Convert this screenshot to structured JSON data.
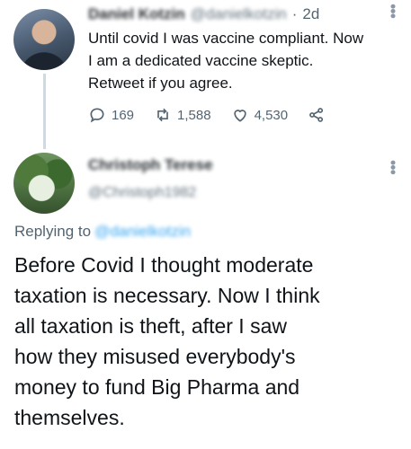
{
  "original_tweet": {
    "author_name": "Daniel Kotzin",
    "author_handle": "@danielkotzin",
    "separator": "·",
    "time": "2d",
    "text_lines": [
      "Until covid I was vaccine compliant. Now",
      "I am a dedicated vaccine skeptic.",
      "Retweet if you agree."
    ],
    "replies": "169",
    "retweets": "1,588",
    "likes": "4,530"
  },
  "reply_tweet": {
    "author_name": "Christoph Terese",
    "author_handle": "@Christoph1982",
    "replying_to_label": "Replying to",
    "replying_to_handle": "@danielkotzin",
    "text_lines": [
      "Before Covid I thought moderate",
      "taxation is necessary. Now I think",
      "all taxation is theft, after I saw",
      "how they misused everybody's",
      "money to fund Big Pharma and",
      "themselves."
    ]
  },
  "icons": {
    "reply": "reply-icon",
    "retweet": "retweet-icon",
    "like": "heart-icon",
    "share": "share-icon",
    "more": "more-icon"
  },
  "colors": {
    "text": "#0f1419",
    "muted": "#536471",
    "thread_line": "#cfd9de",
    "link": "#1d9bf0"
  }
}
